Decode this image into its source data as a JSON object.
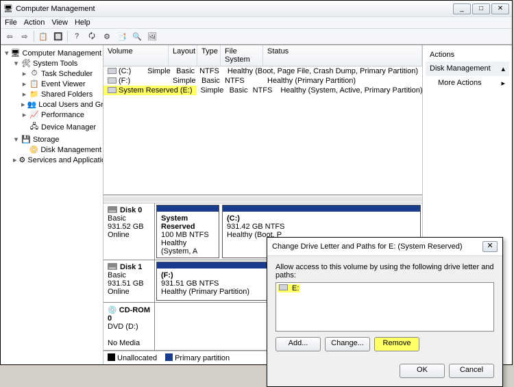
{
  "window": {
    "title": "Computer Management"
  },
  "menu": [
    "File",
    "Action",
    "View",
    "Help"
  ],
  "tree": {
    "root": "Computer Management (Local",
    "systemTools": "System Tools",
    "taskScheduler": "Task Scheduler",
    "eventViewer": "Event Viewer",
    "sharedFolders": "Shared Folders",
    "localUsers": "Local Users and Groups",
    "performance": "Performance",
    "deviceManager": "Device Manager",
    "storage": "Storage",
    "diskManagement": "Disk Management",
    "services": "Services and Applications"
  },
  "volHeader": {
    "volume": "Volume",
    "layout": "Layout",
    "type": "Type",
    "fs": "File System",
    "status": "Status"
  },
  "vols": [
    {
      "vol": "(C:)",
      "layout": "Simple",
      "type": "Basic",
      "fs": "NTFS",
      "status": "Healthy (Boot, Page File, Crash Dump, Primary Partition)"
    },
    {
      "vol": "(F:)",
      "layout": "Simple",
      "type": "Basic",
      "fs": "NTFS",
      "status": "Healthy (Primary Partition)"
    },
    {
      "vol": "System Reserved (E:)",
      "layout": "Simple",
      "type": "Basic",
      "fs": "NTFS",
      "status": "Healthy (System, Active, Primary Partition)"
    }
  ],
  "disks": {
    "d0": {
      "name": "Disk 0",
      "type": "Basic",
      "size": "931.52 GB",
      "state": "Online",
      "p0": {
        "name": "System Reserved",
        "l2": "100 MB NTFS",
        "l3": "Healthy (System, A"
      },
      "p1": {
        "name": "(C:)",
        "l2": "931.42 GB NTFS",
        "l3": "Healthy (Boot, P"
      }
    },
    "d1": {
      "name": "Disk 1",
      "type": "Basic",
      "size": "931.51 GB",
      "state": "Online",
      "p0": {
        "name": "(F:)",
        "l2": "931.51 GB NTFS",
        "l3": "Healthy (Primary Partition)"
      }
    },
    "cd": {
      "name": "CD-ROM 0",
      "type": "DVD (D:)",
      "state": "No Media"
    }
  },
  "legend": {
    "unalloc": "Unallocated",
    "primary": "Primary partition"
  },
  "actions": {
    "header": "Actions",
    "item1": "Disk Management",
    "item2": "More Actions"
  },
  "dialog": {
    "title": "Change Drive Letter and Paths for E: (System Reserved)",
    "label": "Allow access to this volume by using the following drive letter and paths:",
    "entry": "E:",
    "add": "Add...",
    "change": "Change...",
    "remove": "Remove",
    "ok": "OK",
    "cancel": "Cancel"
  }
}
